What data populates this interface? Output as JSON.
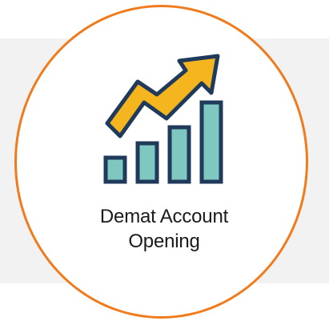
{
  "badge": {
    "line1": "Demat Account",
    "line2": "Opening",
    "icon": "growth-chart-arrow-icon"
  },
  "colors": {
    "ring": "#f07b1d",
    "arrow": "#f5b51e",
    "bars": "#7fc8c2",
    "outline": "#1f3a5a",
    "panel": "#f2f2f2"
  }
}
